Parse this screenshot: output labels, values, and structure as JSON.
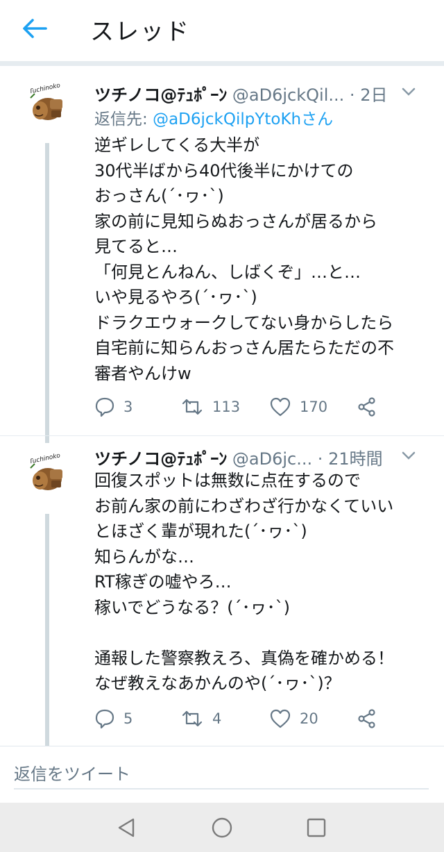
{
  "header": {
    "title": "スレッド"
  },
  "colors": {
    "accent": "#1da1f2",
    "secondary_text": "#657786",
    "thread_line": "#cfd9de"
  },
  "tweets": [
    {
      "author": "ツチノコ@ﾃｭﾎﾟｰﾝ",
      "handle": "@aD6jckQil...",
      "dot": "·",
      "time": "2日",
      "reply_to_prefix": "返信先: ",
      "reply_to_handle": "@aD6jckQilpYtoKhさん",
      "body": "逆ギレしてくる大半が\n30代半ばから40代後半にかけての\nおっさん(´･ヮ･`)\n家の前に見知らぬおっさんが居るから\n見てると…\n「何見とんねん、しばくぞ」…と…\nいや見るやろ(´･ヮ･`)\nドラクエウォークしてない身からしたら\n自宅前に知らんおっさん居たらただの不\n審者やんけw",
      "replies": "3",
      "retweets": "113",
      "likes": "170",
      "avatar_text": "Tuchinoko"
    },
    {
      "author": "ツチノコ@ﾃｭﾎﾟｰﾝ",
      "handle": "@aD6jc...",
      "dot": "·",
      "time": "21時間",
      "body": "回復スポットは無数に点在するので\nお前ん家の前にわざわざ行かなくていい\nとほざく輩が現れた(´･ヮ･`)\n知らんがな…\nRT稼ぎの嘘やろ…\n稼いでどうなる？(´･ヮ･`)\n\n通報した警察教えろ、真偽を確かめる！\nなぜ教えなあかんのや(´･ヮ･`)？",
      "replies": "5",
      "retweets": "4",
      "likes": "20",
      "avatar_text": "Tuchinoko"
    }
  ],
  "reply_bar": {
    "placeholder": "返信をツイート"
  },
  "icons": {
    "back": "arrow-left-icon",
    "caret": "chevron-down-icon",
    "reply": "speech-bubble-icon",
    "retweet": "retweet-icon",
    "like": "heart-icon",
    "share": "share-icon",
    "nav_back": "triangle-back-icon",
    "nav_home": "circle-home-icon",
    "nav_recent": "square-recents-icon"
  }
}
